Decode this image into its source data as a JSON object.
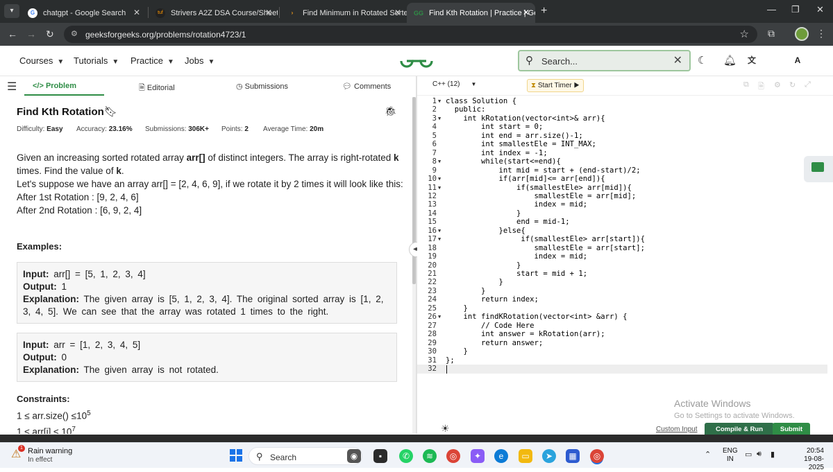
{
  "browser": {
    "tabs": [
      {
        "title": "chatgpt - Google Search",
        "active": false
      },
      {
        "title": "Strivers A2Z DSA Course/Sheet",
        "active": false
      },
      {
        "title": "Find Minimum in Rotated Sorte",
        "active": false
      },
      {
        "title": "Find Kth Rotation | Practice | Ge",
        "active": true
      }
    ],
    "url": "geeksforgeeks.org/problems/rotation4723/1"
  },
  "header": {
    "menu": [
      "Courses",
      "Tutorials",
      "Practice",
      "Jobs"
    ],
    "search_placeholder": "Search...",
    "avatar_letter": "A",
    "brand_color": "#2f8d46"
  },
  "left_tabs": [
    "Problem",
    "Editorial",
    "Submissions",
    "Comments"
  ],
  "problem": {
    "title": "Find Kth Rotation",
    "meta": {
      "difficulty_label": "Difficulty:",
      "difficulty": "Easy",
      "accuracy_label": "Accuracy:",
      "accuracy": "23.16%",
      "submissions_label": "Submissions:",
      "submissions": "306K+",
      "points_label": "Points:",
      "points": "2",
      "avg_time_label": "Average Time:",
      "avg_time": "20m"
    },
    "desc": {
      "p1a": "Given an increasing sorted rotated array ",
      "p1b": "arr[]",
      "p1c": " of distinct integers. The array is right-rotated ",
      "p1d": "k",
      "p1e": " times. Find the value of ",
      "p1f": "k",
      "p1g": ".",
      "p2": "Let's suppose we have an array arr[] = [2, 4, 6, 9], if we rotate it by 2 times it will look like this:",
      "p3": "After 1st Rotation : [9, 2, 4, 6]",
      "p4": "After 2nd Rotation : [6, 9, 2, 4]"
    },
    "examples_heading": "Examples:",
    "examples": [
      {
        "input_label": "Input:",
        "input": "arr[] = [5, 1, 2, 3, 4]",
        "output_label": "Output:",
        "output": "1",
        "expl_label": "Explanation:",
        "explanation": "The given array is [5, 1, 2, 3, 4]. The original sorted array is [1, 2, 3, 4, 5]. We can see that the array was rotated 1 times to the right."
      },
      {
        "input_label": "Input:",
        "input": "arr = [1, 2, 3, 4, 5]",
        "output_label": "Output:",
        "output": "0",
        "expl_label": "Explanation:",
        "explanation": "The given array is not rotated."
      }
    ],
    "constraints_heading": "Constraints:",
    "constraints": [
      {
        "text": "1 ≤ arr.size() ≤10",
        "exp": "5"
      },
      {
        "text": "1 ≤ arr[i] ≤ 10",
        "exp": "7"
      }
    ]
  },
  "editor": {
    "language": "C++ (12)",
    "timer_label": "Start Timer",
    "lines": [
      "class Solution {",
      "  public:",
      "    int kRotation(vector<int>& arr){",
      "        int start = 0;",
      "        int end = arr.size()-1;",
      "        int smallestEle = INT_MAX;",
      "        int index = -1;",
      "        while(start<=end){",
      "            int mid = start + (end-start)/2;",
      "            if(arr[mid]<= arr[end]){",
      "                if(smallestEle> arr[mid]){",
      "                    smallestEle = arr[mid];",
      "                    index = mid;",
      "                }",
      "                end = mid-1;",
      "            }else{",
      "                 if(smallestEle> arr[start]){",
      "                    smallestEle = arr[start];",
      "                    index = mid;",
      "                }",
      "                start = mid + 1;",
      "            }",
      "        }",
      "        return index;",
      "    }",
      "    int findKRotation(vector<int> &arr) {",
      "        // Code Here",
      "        int answer = kRotation(arr);",
      "        return answer;",
      "    }",
      "};",
      ""
    ],
    "fold_lines": [
      1,
      3,
      8,
      10,
      11,
      16,
      17,
      26
    ],
    "custom_input": "Custom Input",
    "compile_run": "Compile & Run",
    "submit": "Submit"
  },
  "watermark": {
    "line1": "Activate Windows",
    "line2": "Go to Settings to activate Windows."
  },
  "taskbar": {
    "weather_title": "Rain warning",
    "weather_sub": "In effect",
    "weather_badge": "1",
    "search": "Search",
    "lang1": "ENG",
    "lang2": "IN",
    "time": "20:54",
    "date": "19-08-2025"
  }
}
